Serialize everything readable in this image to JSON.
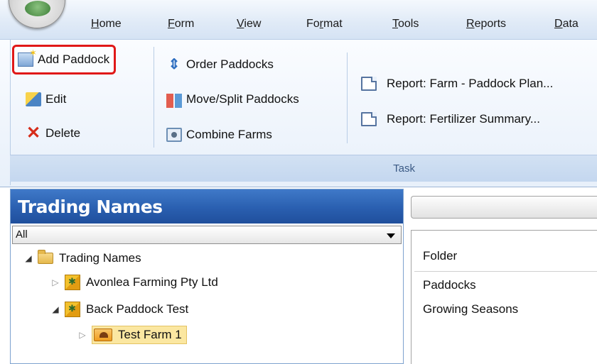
{
  "menu": {
    "items": [
      {
        "label_u": "H",
        "label_rest": "ome"
      },
      {
        "label_u": "F",
        "label_rest": "orm"
      },
      {
        "label_u": "V",
        "label_rest": "iew"
      },
      {
        "label_pre": "Fo",
        "label_u": "r",
        "label_rest": "mat"
      },
      {
        "label_u": "T",
        "label_rest": "ools"
      },
      {
        "label_u": "R",
        "label_rest": "eports"
      },
      {
        "label_u": "D",
        "label_rest": "ata"
      }
    ]
  },
  "ribbon": {
    "group_label": "Task",
    "add_paddock": "Add Paddock",
    "edit": "Edit",
    "delete": "Delete",
    "order_paddocks": "Order Paddocks",
    "move_split_paddocks": "Move/Split Paddocks",
    "combine_farms": "Combine Farms",
    "report_paddock_plan": "Report: Farm - Paddock Plan...",
    "report_fertilizer": "Report: Fertilizer Summary..."
  },
  "left_panel": {
    "title": "Trading Names",
    "filter_value": "All",
    "tree": {
      "root": "Trading Names",
      "node_avonlea": "Avonlea Farming Pty Ltd",
      "node_back_paddock": "Back Paddock Test",
      "node_test_farm": "Test Farm 1"
    }
  },
  "right_panel": {
    "column_header": "Folder",
    "items": [
      "Paddocks",
      "Growing Seasons"
    ]
  },
  "icons": {
    "add_paddock": "add-paddock-icon",
    "edit": "edit-icon",
    "delete": "delete-icon",
    "order": "order-arrows-icon",
    "move_split": "move-split-icon",
    "combine": "combine-farms-icon",
    "report": "document-icon",
    "folder": "folder-icon",
    "trading_name": "trading-name-icon",
    "farm": "farm-icon"
  },
  "colors": {
    "highlight_border": "#e01818",
    "panel_header": "#2a5fb0",
    "selected_node": "#fbe7a1"
  }
}
